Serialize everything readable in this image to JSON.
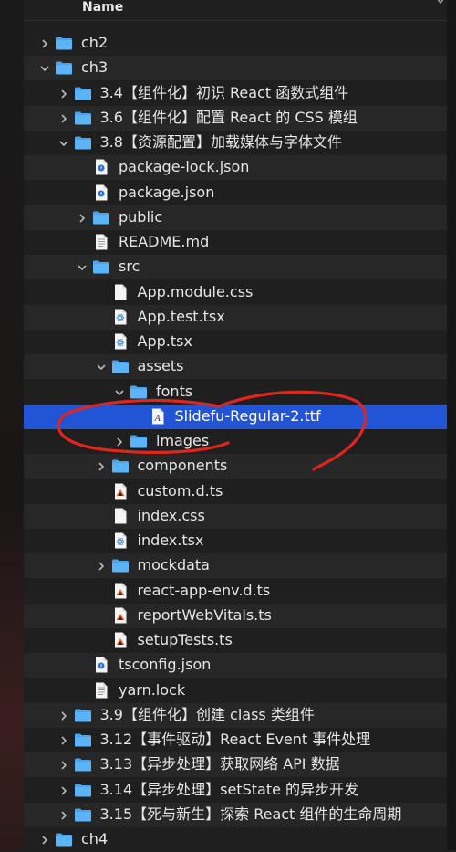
{
  "header": {
    "name_label": "Name"
  },
  "rows": [
    {
      "label": "ch2",
      "depth": 0,
      "chevron": "right",
      "icon": "folder"
    },
    {
      "label": "ch3",
      "depth": 0,
      "chevron": "down",
      "icon": "folder"
    },
    {
      "label": "3.4【组件化】初识 React 函数式组件",
      "depth": 1,
      "chevron": "right",
      "icon": "folder"
    },
    {
      "label": "3.6【组件化】配置 React 的 CSS 模组",
      "depth": 1,
      "chevron": "right",
      "icon": "folder"
    },
    {
      "label": "3.8【资源配置】加载媒体与字体文件",
      "depth": 1,
      "chevron": "down",
      "icon": "folder"
    },
    {
      "label": "package-lock.json",
      "depth": 2,
      "chevron": "none",
      "icon": "json-file"
    },
    {
      "label": "package.json",
      "depth": 2,
      "chevron": "none",
      "icon": "json-file"
    },
    {
      "label": "public",
      "depth": 2,
      "chevron": "right",
      "icon": "folder"
    },
    {
      "label": "README.md",
      "depth": 2,
      "chevron": "none",
      "icon": "text-file"
    },
    {
      "label": "src",
      "depth": 2,
      "chevron": "down",
      "icon": "folder"
    },
    {
      "label": "App.module.css",
      "depth": 3,
      "chevron": "none",
      "icon": "plain-file"
    },
    {
      "label": "App.test.tsx",
      "depth": 3,
      "chevron": "none",
      "icon": "react-file"
    },
    {
      "label": "App.tsx",
      "depth": 3,
      "chevron": "none",
      "icon": "react-file"
    },
    {
      "label": "assets",
      "depth": 3,
      "chevron": "down",
      "icon": "folder"
    },
    {
      "label": "fonts",
      "depth": 4,
      "chevron": "down",
      "icon": "folder"
    },
    {
      "label": "Slidefu-Regular-2.ttf",
      "depth": 5,
      "chevron": "none",
      "icon": "font-file",
      "selected": true
    },
    {
      "label": "images",
      "depth": 4,
      "chevron": "right",
      "icon": "folder"
    },
    {
      "label": "components",
      "depth": 3,
      "chevron": "right",
      "icon": "folder"
    },
    {
      "label": "custom.d.ts",
      "depth": 3,
      "chevron": "none",
      "icon": "ts-file"
    },
    {
      "label": "index.css",
      "depth": 3,
      "chevron": "none",
      "icon": "plain-file"
    },
    {
      "label": "index.tsx",
      "depth": 3,
      "chevron": "none",
      "icon": "react-file"
    },
    {
      "label": "mockdata",
      "depth": 3,
      "chevron": "right",
      "icon": "folder"
    },
    {
      "label": "react-app-env.d.ts",
      "depth": 3,
      "chevron": "none",
      "icon": "ts-file"
    },
    {
      "label": "reportWebVitals.ts",
      "depth": 3,
      "chevron": "none",
      "icon": "ts-file"
    },
    {
      "label": "setupTests.ts",
      "depth": 3,
      "chevron": "none",
      "icon": "ts-file"
    },
    {
      "label": "tsconfig.json",
      "depth": 2,
      "chevron": "none",
      "icon": "json-file"
    },
    {
      "label": "yarn.lock",
      "depth": 2,
      "chevron": "none",
      "icon": "text-file"
    },
    {
      "label": "3.9【组件化】创建 class 类组件",
      "depth": 1,
      "chevron": "right",
      "icon": "folder"
    },
    {
      "label": "3.12【事件驱动】React Event 事件处理",
      "depth": 1,
      "chevron": "right",
      "icon": "folder"
    },
    {
      "label": "3.13【异步处理】获取网络 API 数据",
      "depth": 1,
      "chevron": "right",
      "icon": "folder"
    },
    {
      "label": "3.14【异步处理】setState 的异步开发",
      "depth": 1,
      "chevron": "right",
      "icon": "folder"
    },
    {
      "label": "3.15【死与新生】探索 React 组件的生命周期",
      "depth": 1,
      "chevron": "right",
      "icon": "folder"
    },
    {
      "label": "ch4",
      "depth": 0,
      "chevron": "right",
      "icon": "folder"
    }
  ],
  "colors": {
    "selection": "#2255d6",
    "folder": "#4aa3f0",
    "annotation": "#e0261c"
  }
}
